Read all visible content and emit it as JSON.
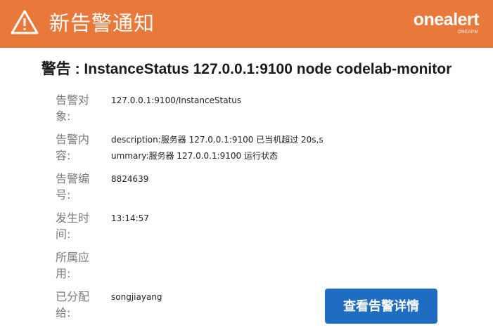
{
  "header": {
    "title": "新告警通知",
    "background_color": "#e8793a",
    "icon": "warning-triangle-icon",
    "logo_text": "onealert",
    "logo_subtext": "ONEAPM"
  },
  "alert_title": "警告 : InstanceStatus 127.0.0.1:9100 node codelab-monitor",
  "fields": {
    "target": {
      "label": "告警对象:",
      "value": "127.0.0.1:9100/InstanceStatus"
    },
    "content": {
      "label": "告警内容:",
      "value_line1": "description:服务器 127.0.0.1:9100 已当机超过 20s,s",
      "value_line2": "ummary:服务器 127.0.0.1:9100 运行状态"
    },
    "number": {
      "label": "告警编号:",
      "value": "8824639"
    },
    "time": {
      "label": "发生时间:",
      "value": "13:14:57"
    },
    "app": {
      "label": "所属应用:",
      "value": ""
    },
    "assignee": {
      "label": "已分配给:",
      "value": "songjiayang"
    }
  },
  "detail_button": {
    "label": "查看告警详情",
    "color": "#1e6dc2"
  }
}
